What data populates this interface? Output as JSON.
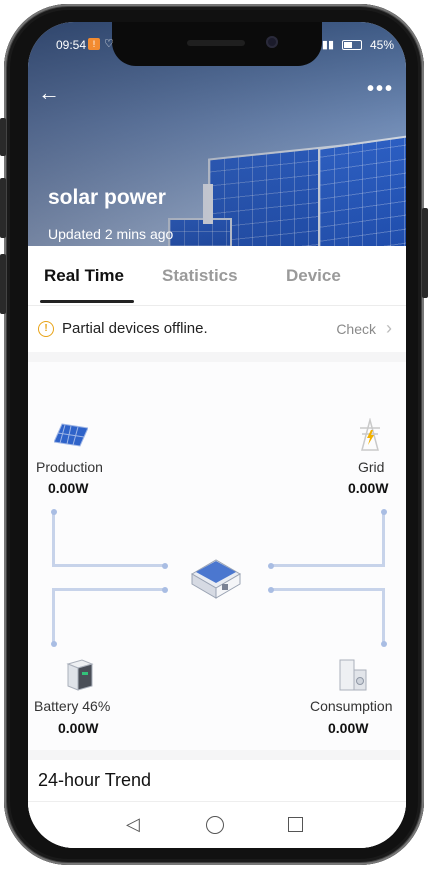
{
  "status_bar": {
    "time": "09:54",
    "battery_pct": "45%"
  },
  "header": {
    "title": "solar power",
    "updated": "Updated 2 mins ago"
  },
  "tabs": [
    {
      "label": "Real Time",
      "active": true
    },
    {
      "label": "Statistics",
      "active": false
    },
    {
      "label": "Device",
      "active": false
    }
  ],
  "notice": {
    "text": "Partial devices offline.",
    "action": "Check"
  },
  "energy_flow": {
    "production": {
      "label": "Production",
      "value": "0.00W"
    },
    "grid": {
      "label": "Grid",
      "value": "0.00W"
    },
    "battery": {
      "label": "Battery",
      "percent": "46%",
      "value": "0.00W"
    },
    "consumption": {
      "label": "Consumption",
      "value": "0.00W"
    }
  },
  "trend": {
    "title": "24-hour Trend"
  },
  "colors": {
    "accent": "#222222",
    "flow_line": "#c7d3ea",
    "warning": "#e8a317"
  }
}
